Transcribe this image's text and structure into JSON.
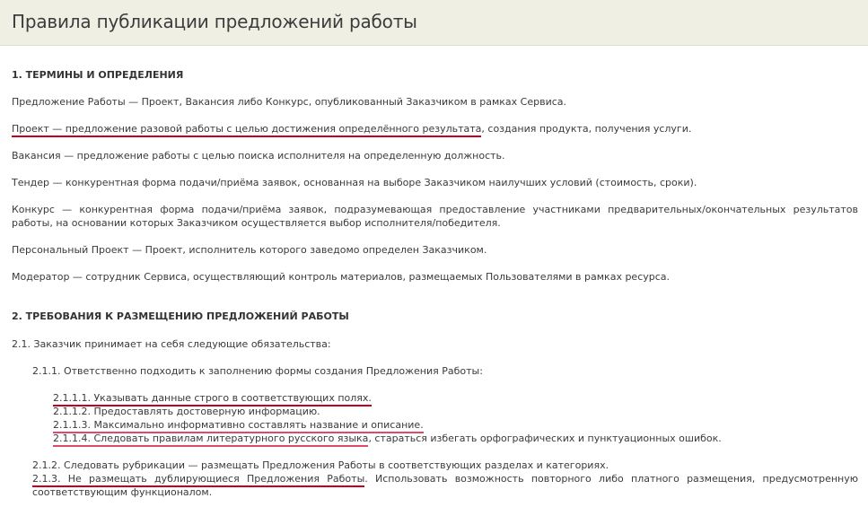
{
  "page": {
    "title": "Правила публикации предложений работы"
  },
  "section1": {
    "heading": "1. ТЕРМИНЫ И ОПРЕДЕЛЕНИЯ",
    "def_offer": "Предложение Работы — Проект, Вакансия либо Конкурс, опубликованный Заказчиком в рамках Сервиса.",
    "def_project_underlined": "Проект — предложение разовой работы с целью достижения определённого результата",
    "def_project_rest": ", создания продукта, получения услуги.",
    "def_vacancy": "Вакансия — предложение работы с целью поиска исполнителя на определенную должность.",
    "def_tender": "Тендер — конкурентная форма подачи/приёма заявок, основанная на выборе Заказчиком наилучших условий (стоимость, сроки).",
    "def_contest": "Конкурс — конкурентная форма подачи/приёма заявок, подразумевающая предоставление участниками предварительных/окончательных результатов работы, на основании которых Заказчиком осуществляется выбор исполнителя/победителя.",
    "def_personal": "Персональный Проект — Проект, исполнитель которого заведомо определен Заказчиком.",
    "def_moderator": "Модератор — сотрудник Сервиса, осуществляющий контроль материалов, размещаемых Пользователями в рамках ресурса."
  },
  "section2": {
    "heading": "2. ТРЕБОВАНИЯ К РАЗМЕЩЕНИЮ ПРЕДЛОЖЕНИЙ РАБОТЫ",
    "p2_1": "2.1. Заказчик принимает на себя следующие обязательства:",
    "p2_1_1": "2.1.1. Ответственно подходить к заполнению формы создания Предложения Работы:",
    "p2_1_1_1": "2.1.1.1. Указывать данные строго в соответствующих полях.",
    "p2_1_1_2": "2.1.1.2. Предоставлять достоверную информацию.",
    "p2_1_1_3": "2.1.1.3. Максимально информативно составлять название и описание.",
    "p2_1_1_4_underlined": "2.1.1.4. Следовать правилам литературного русского языка",
    "p2_1_1_4_rest": ", стараться избегать орфографических и пунктуационных ошибок.",
    "p2_1_2": "2.1.2. Следовать рубрикации — размещать Предложения Работы в соответствующих разделах и категориях.",
    "p2_1_3_underlined": "2.1.3. Не размещать дублирующиеся Предложения Работы",
    "p2_1_3_rest": ". Использовать возможность повторного либо платного размещения, предусмотренную соответствующим функционалом."
  },
  "colors": {
    "title_bg": "#efefe4",
    "text": "#3a3a3a",
    "underline_red": "#c8001e",
    "underline_pink": "#e04a6a"
  }
}
